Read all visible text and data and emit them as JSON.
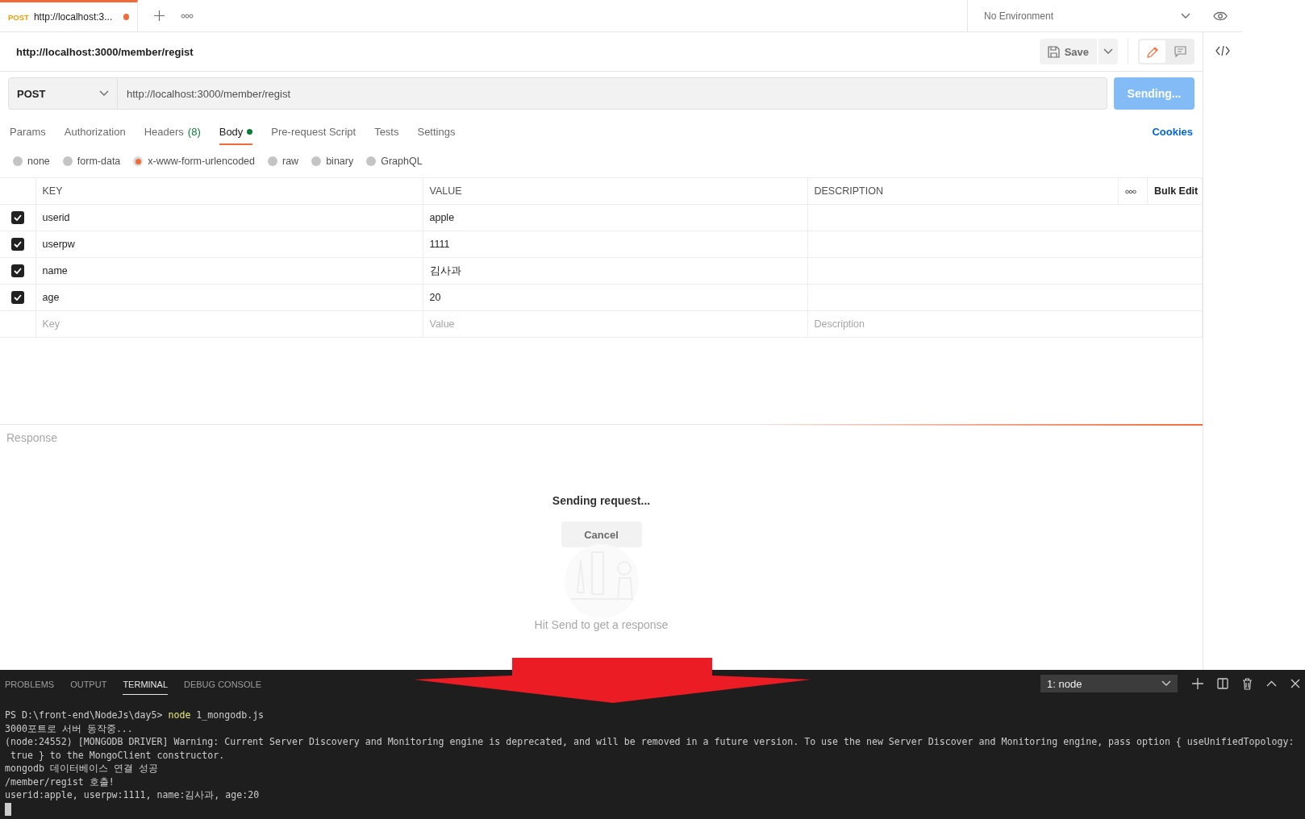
{
  "tab": {
    "method": "POST",
    "title": "http://localhost:3...",
    "unsaved": true
  },
  "environment": "No Environment",
  "request_name": "http://localhost:3000/member/regist",
  "save_button": "Save",
  "mode_toggle": [
    {
      "kind": "edit",
      "selected": true
    },
    {
      "kind": "comments",
      "selected": false
    }
  ],
  "method": "POST",
  "url": "http://localhost:3000/member/regist",
  "send_button": "Sending...",
  "request_tabs": [
    {
      "label": "Params",
      "selected": false,
      "has_content": false
    },
    {
      "label": "Authorization",
      "selected": false,
      "has_content": false
    },
    {
      "label": "Headers",
      "count": "(8)",
      "selected": false,
      "has_content": false
    },
    {
      "label": "Body",
      "selected": true,
      "has_content": true
    },
    {
      "label": "Pre-request Script",
      "selected": false,
      "has_content": false
    },
    {
      "label": "Tests",
      "selected": false,
      "has_content": false
    },
    {
      "label": "Settings",
      "selected": false,
      "has_content": false
    }
  ],
  "cookies": "Cookies",
  "body_types": [
    {
      "label": "none",
      "selected": false
    },
    {
      "label": "form-data",
      "selected": false
    },
    {
      "label": "x-www-form-urlencoded",
      "selected": true
    },
    {
      "label": "raw",
      "selected": false
    },
    {
      "label": "binary",
      "selected": false
    },
    {
      "label": "GraphQL",
      "selected": false
    }
  ],
  "table": {
    "columns": [
      "KEY",
      "VALUE",
      "DESCRIPTION"
    ],
    "bulk_edit": "Bulk Edit",
    "rows": [
      {
        "checked": true,
        "key": "userid",
        "value": "apple"
      },
      {
        "checked": true,
        "key": "userpw",
        "value": "1111"
      },
      {
        "checked": true,
        "key": "name",
        "value": "김사과"
      },
      {
        "checked": true,
        "key": "age",
        "value": "20"
      }
    ],
    "new_row": [
      {
        "placeholder": "Key"
      },
      {
        "placeholder": "Value"
      },
      {
        "placeholder": "Description"
      }
    ]
  },
  "response": {
    "title": "Response",
    "status": "Sending request...",
    "cancel_button": "Cancel",
    "hint": "Hit Send to get a response"
  },
  "terminal": {
    "tabs": [
      {
        "label": "PROBLEMS",
        "selected": false
      },
      {
        "label": "OUTPUT",
        "selected": false
      },
      {
        "label": "TERMINAL",
        "selected": true
      },
      {
        "label": "DEBUG CONSOLE",
        "selected": false
      }
    ],
    "selector": "1: node",
    "prompt": "PS D:\\front-end\\NodeJs\\day5>",
    "command": "node",
    "args": "1_mongodb.js",
    "lines": [
      "3000포트로 서버 동작중...",
      "(node:24552) [MONGODB DRIVER] Warning: Current Server Discovery and Monitoring engine is deprecated, and will be removed in a future version. To use the new Server Discover and Monitoring engine, pass option { useUnifiedTopology:",
      " true } to the MongoClient constructor.",
      "mongodb 데이터베이스 연결 성공",
      "/member/regist 호출!",
      "userid:apple, userpw:1111, name:김사과, age:20"
    ]
  }
}
